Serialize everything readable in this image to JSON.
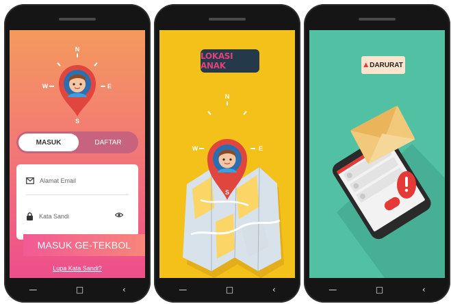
{
  "screen_login": {
    "compass": {
      "north": "N",
      "south": "S",
      "east": "E",
      "west": "W"
    },
    "tabs": {
      "login": "MASUK",
      "register": "DAFTAR"
    },
    "email_placeholder": "Alamat Email",
    "password_placeholder": "Kata Sandi",
    "login_button": "MASUK GE-TEKBOL",
    "forgot_password": "Lupa Kata Sandi?"
  },
  "screen_location": {
    "title": "LOKASI ANAK",
    "compass": {
      "north": "N",
      "south": "S",
      "east": "E",
      "west": "W"
    }
  },
  "screen_emergency": {
    "title": "DARURAT",
    "warning_icon": "warning-triangle-icon"
  },
  "colors": {
    "login_gradient_top": "#f49a5d",
    "login_gradient_bottom": "#ee4e8b",
    "location_bg": "#f3c11a",
    "emergency_bg": "#52c0a3",
    "badge_bg": "#24394a",
    "badge_text": "#e0427b",
    "pin_red": "#e0453e"
  }
}
